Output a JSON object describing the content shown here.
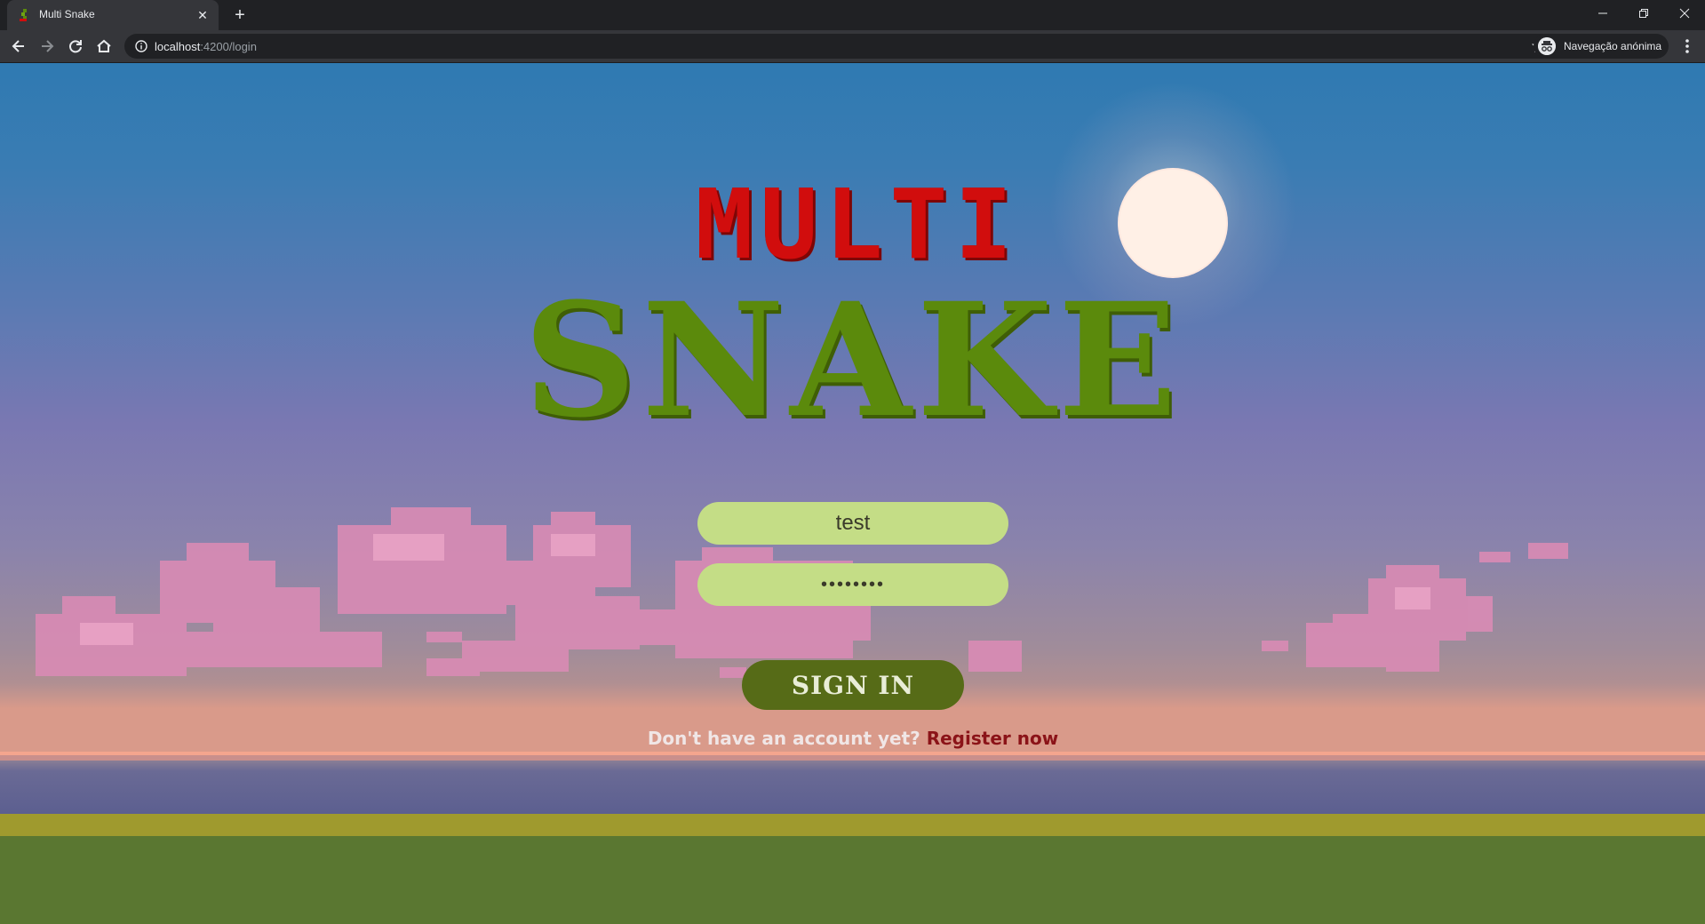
{
  "browser": {
    "tab_title": "Multi Snake",
    "new_tab_symbol": "+",
    "close_symbol": "✕",
    "url_host": "localhost",
    "url_path": ":4200/login",
    "profile_label": "Navegação anónima"
  },
  "page": {
    "title_line1": "MULTI",
    "title_line2": "SNAKE",
    "username_value": "test",
    "password_value": "••••••••",
    "signin_label": "SIGN IN",
    "register_prompt": "Don't have an account yet?",
    "register_link": "Register now"
  },
  "colors": {
    "title_red": "#d10d0d",
    "title_green": "#5b8a0c",
    "field_bg": "#c4dd86",
    "button_bg": "#566b17",
    "link_color": "#8b1318"
  }
}
